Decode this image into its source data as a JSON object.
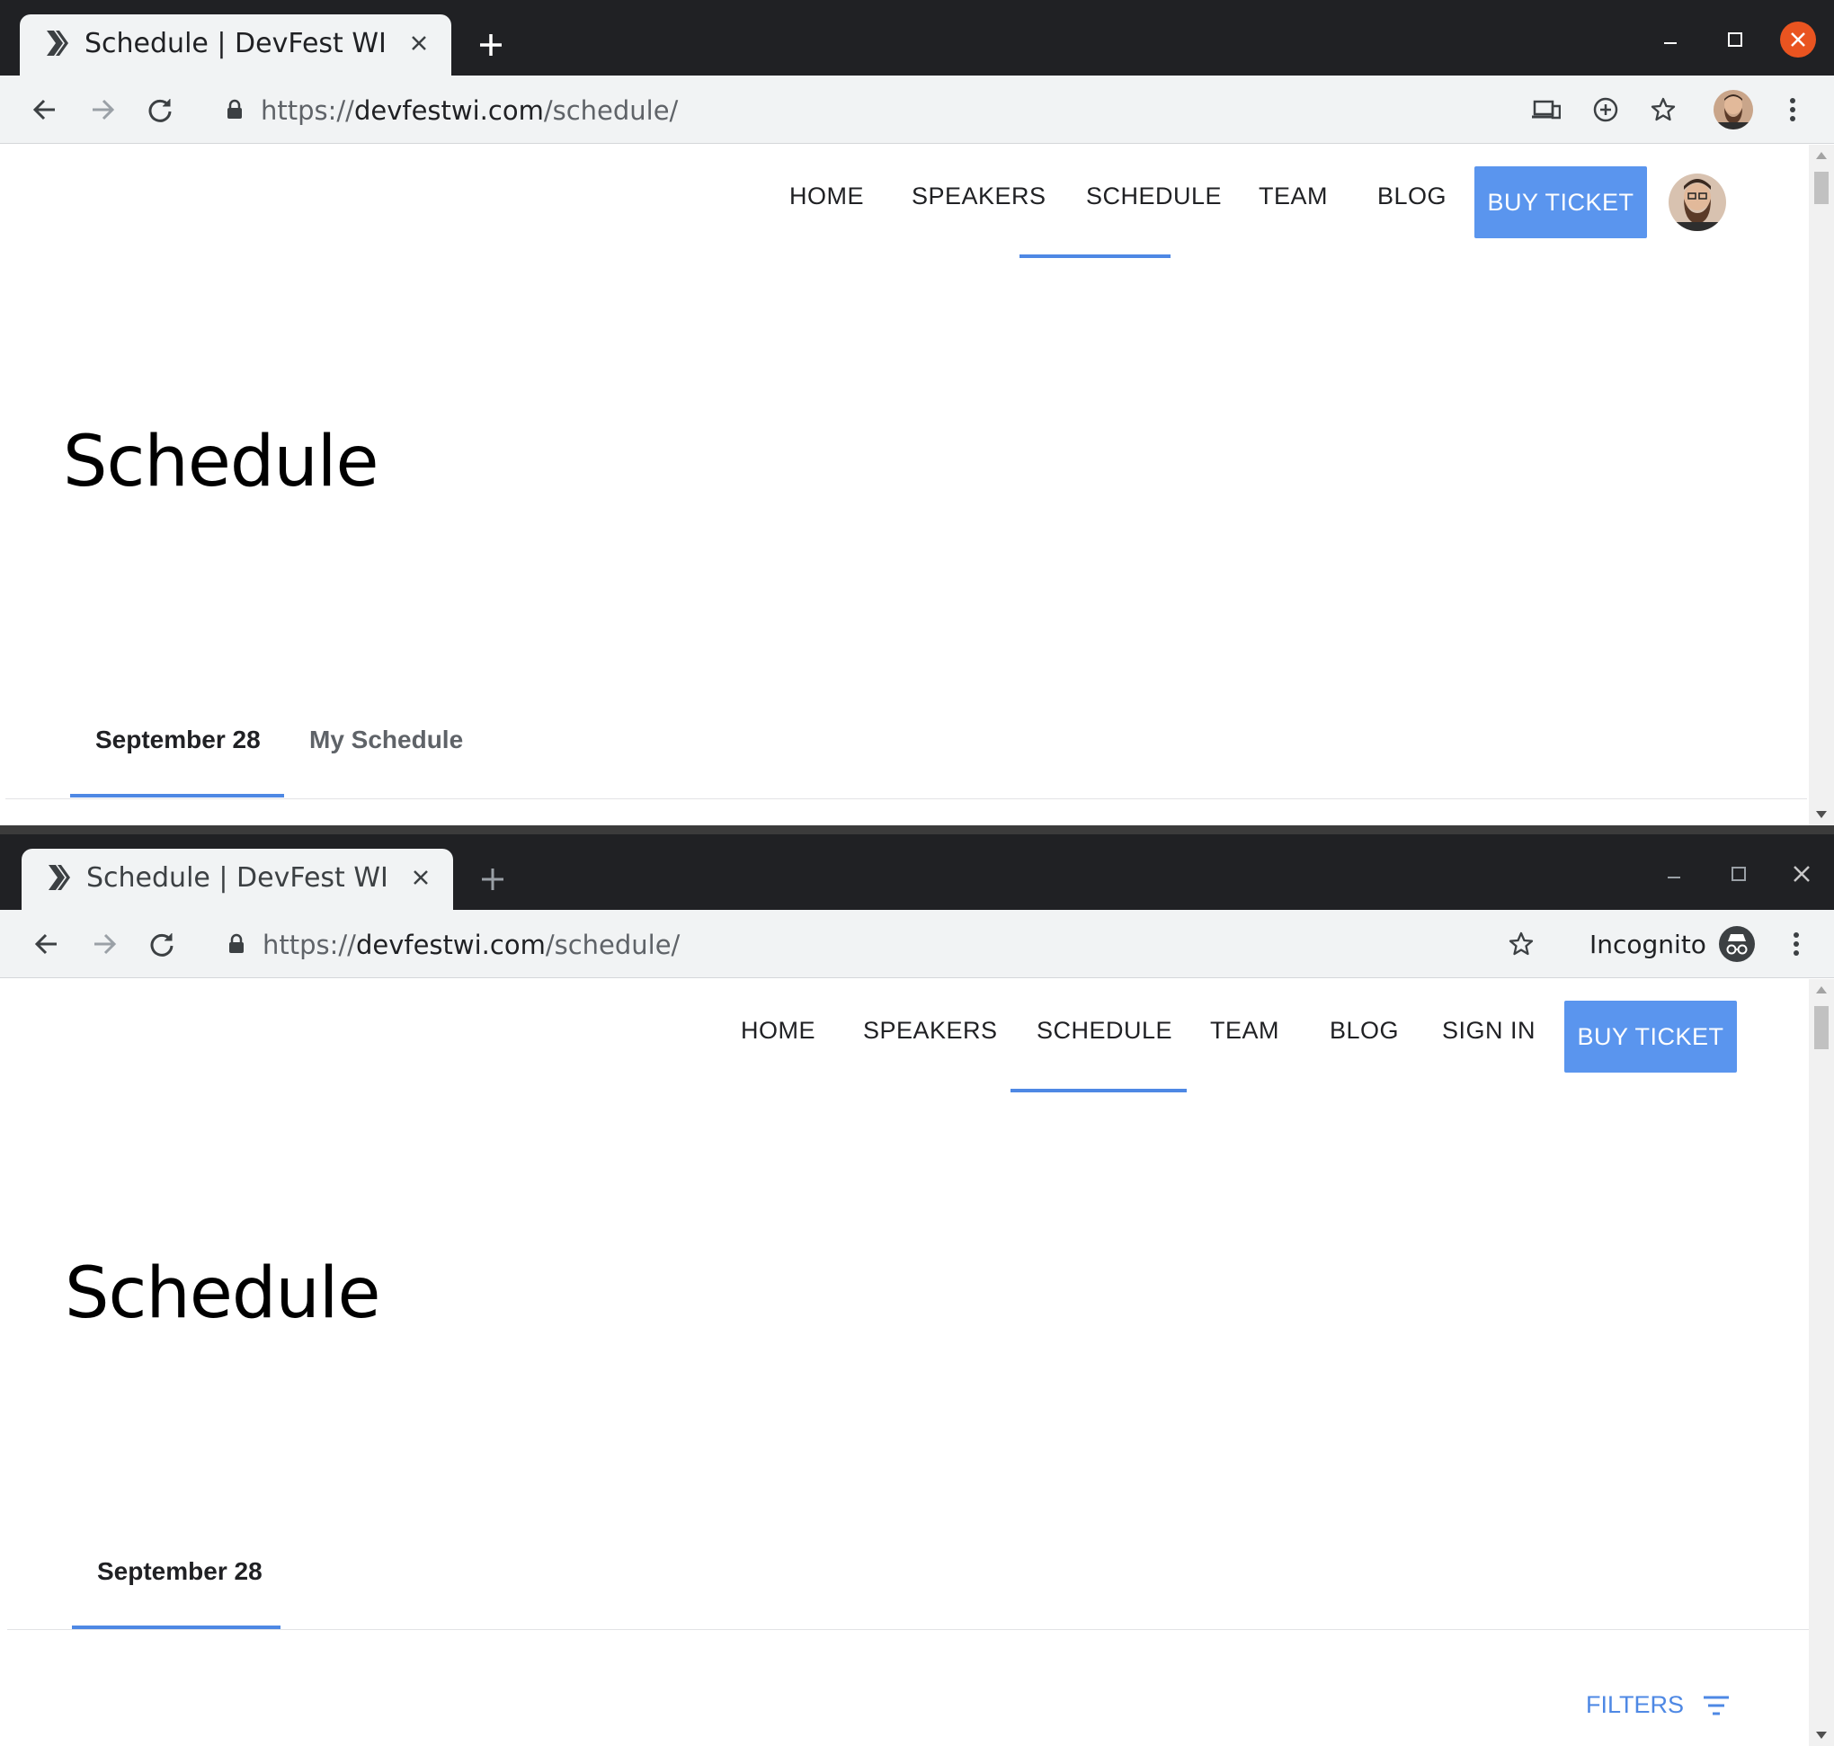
{
  "windows": [
    {
      "tab_title": "Schedule | DevFest WI",
      "url_scheme": "https://",
      "url_host": "devfestwi.com",
      "url_path": "/schedule/",
      "nav": [
        "HOME",
        "SPEAKERS",
        "SCHEDULE",
        "TEAM",
        "BLOG"
      ],
      "buy_ticket": "BUY TICKET",
      "page_title": "Schedule",
      "tabs": [
        "September 28",
        "My Schedule"
      ]
    },
    {
      "tab_title": "Schedule | DevFest WI",
      "url_scheme": "https://",
      "url_host": "devfestwi.com",
      "url_path": "/schedule/",
      "incognito_label": "Incognito",
      "nav": [
        "HOME",
        "SPEAKERS",
        "SCHEDULE",
        "TEAM",
        "BLOG",
        "SIGN IN"
      ],
      "buy_ticket": "BUY TICKET",
      "page_title": "Schedule",
      "tabs": [
        "September 28"
      ],
      "filters_label": "FILTERS"
    }
  ],
  "colors": {
    "accent": "#4e88e4",
    "button": "#5a95ee",
    "titlebar": "#202124",
    "toolbar": "#f1f3f4",
    "close_button": "#e95420"
  }
}
